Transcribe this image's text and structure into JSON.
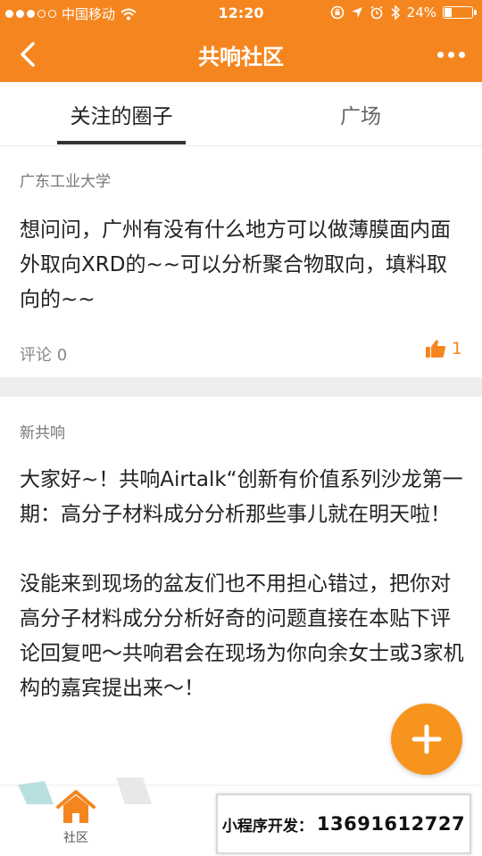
{
  "status_bar": {
    "carrier": "中国移动",
    "time": "12:20",
    "battery_text": "24%",
    "battery_level": 0.24
  },
  "nav": {
    "title": "共响社区"
  },
  "tabs": [
    {
      "label": "关注的圈子",
      "active": true
    },
    {
      "label": "广场",
      "active": false
    }
  ],
  "posts": [
    {
      "source": "广东工业大学",
      "body": "想问问，广州有没有什么地方可以做薄膜面内面外取向XRD的~~可以分析聚合物取向，填料取向的~~",
      "comment_label": "评论 0",
      "likes": "1"
    },
    {
      "source": "新共响",
      "body": "大家好~！共响Airtalk“创新有价值系列沙龙第一期：高分子材料成分分析那些事儿就在明天啦！\n\n没能来到现场的盆友们也不用担心错过，把你对高分子材料成分分析好奇的问题直接在本贴下评论回复吧～共响君会在现场为你向余女士或3家机构的嘉宾提出来～！"
    }
  ],
  "bottom_nav": {
    "home_label": "社区"
  },
  "promo": {
    "label": "小程序开发：",
    "phone": "13691612727"
  },
  "colors": {
    "accent": "#f5861f",
    "fab": "#f7941d"
  },
  "icons": {
    "back": "back-arrow-icon",
    "more": "more-dots-icon",
    "like": "thumbs-up-icon",
    "add": "plus-icon",
    "home": "home-icon"
  }
}
